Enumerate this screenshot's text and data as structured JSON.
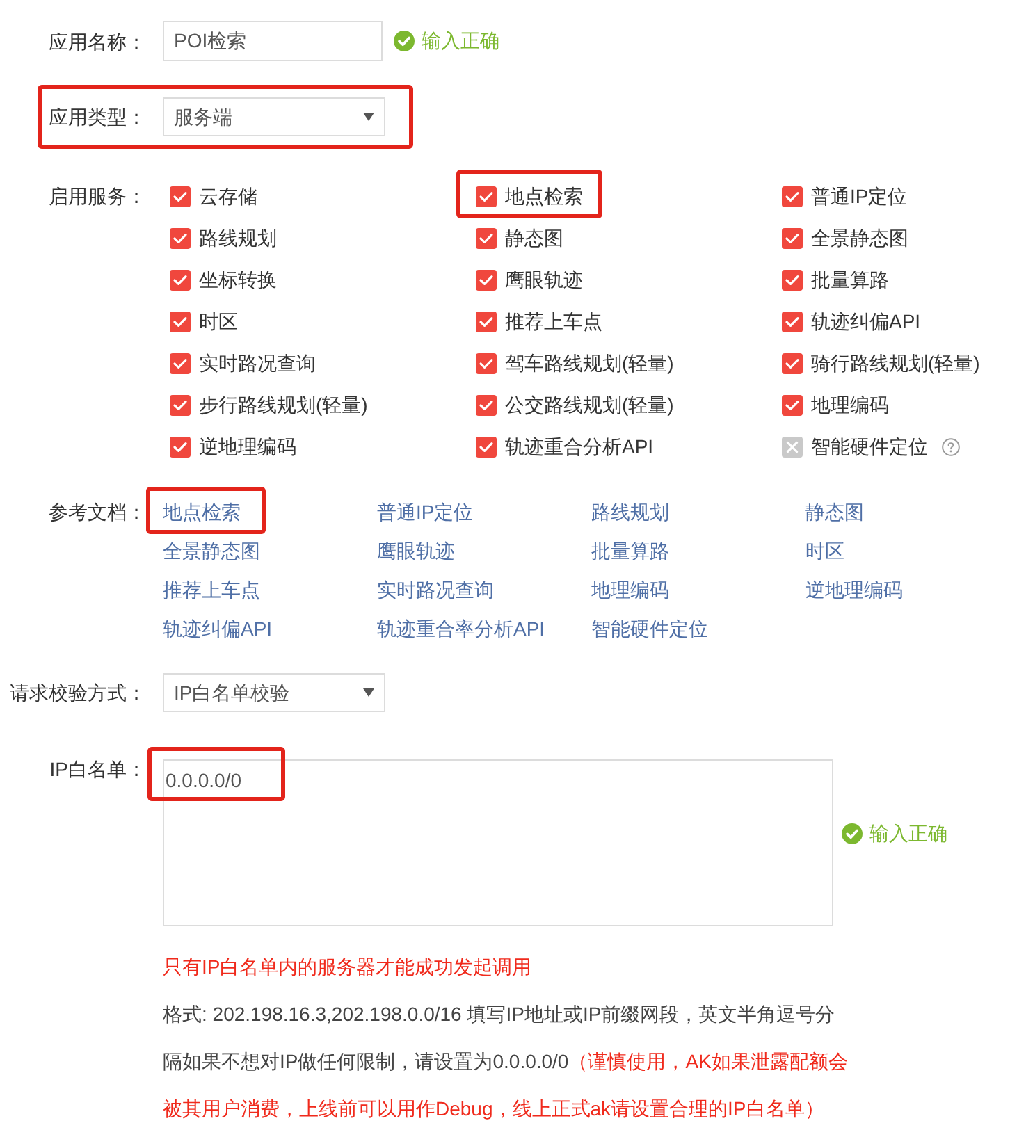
{
  "app_name": {
    "label": "应用名称：",
    "value": "POI检索",
    "validation": "输入正确"
  },
  "app_type": {
    "label": "应用类型：",
    "value": "服务端",
    "highlighted": true
  },
  "services": {
    "label": "启用服务：",
    "items": [
      {
        "label": "云存储",
        "checked": true,
        "highlighted": false,
        "help": false
      },
      {
        "label": "地点检索",
        "checked": true,
        "highlighted": true,
        "help": false
      },
      {
        "label": "普通IP定位",
        "checked": true,
        "highlighted": false,
        "help": false
      },
      {
        "label": "路线规划",
        "checked": true,
        "highlighted": false,
        "help": false
      },
      {
        "label": "静态图",
        "checked": true,
        "highlighted": false,
        "help": false
      },
      {
        "label": "全景静态图",
        "checked": true,
        "highlighted": false,
        "help": false
      },
      {
        "label": "坐标转换",
        "checked": true,
        "highlighted": false,
        "help": false
      },
      {
        "label": "鹰眼轨迹",
        "checked": true,
        "highlighted": false,
        "help": false
      },
      {
        "label": "批量算路",
        "checked": true,
        "highlighted": false,
        "help": false
      },
      {
        "label": "时区",
        "checked": true,
        "highlighted": false,
        "help": false
      },
      {
        "label": "推荐上车点",
        "checked": true,
        "highlighted": false,
        "help": false
      },
      {
        "label": "轨迹纠偏API",
        "checked": true,
        "highlighted": false,
        "help": false
      },
      {
        "label": "实时路况查询",
        "checked": true,
        "highlighted": false,
        "help": false
      },
      {
        "label": "驾车路线规划(轻量)",
        "checked": true,
        "highlighted": false,
        "help": false
      },
      {
        "label": "骑行路线规划(轻量)",
        "checked": true,
        "highlighted": false,
        "help": false
      },
      {
        "label": "步行路线规划(轻量)",
        "checked": true,
        "highlighted": false,
        "help": false
      },
      {
        "label": "公交路线规划(轻量)",
        "checked": true,
        "highlighted": false,
        "help": false
      },
      {
        "label": "地理编码",
        "checked": true,
        "highlighted": false,
        "help": false
      },
      {
        "label": "逆地理编码",
        "checked": true,
        "highlighted": false,
        "help": false
      },
      {
        "label": "轨迹重合分析API",
        "checked": true,
        "highlighted": false,
        "help": false
      },
      {
        "label": "智能硬件定位",
        "checked": false,
        "highlighted": false,
        "help": true
      }
    ]
  },
  "docs": {
    "label": "参考文档：",
    "links": [
      {
        "label": "地点检索",
        "highlighted": true
      },
      {
        "label": "普通IP定位",
        "highlighted": false
      },
      {
        "label": "路线规划",
        "highlighted": false
      },
      {
        "label": "静态图",
        "highlighted": false
      },
      {
        "label": "全景静态图",
        "highlighted": false
      },
      {
        "label": "鹰眼轨迹",
        "highlighted": false
      },
      {
        "label": "批量算路",
        "highlighted": false
      },
      {
        "label": "时区",
        "highlighted": false
      },
      {
        "label": "推荐上车点",
        "highlighted": false
      },
      {
        "label": "实时路况查询",
        "highlighted": false
      },
      {
        "label": "地理编码",
        "highlighted": false
      },
      {
        "label": "逆地理编码",
        "highlighted": false
      },
      {
        "label": "轨迹纠偏API",
        "highlighted": false
      },
      {
        "label": "轨迹重合率分析API",
        "highlighted": false
      },
      {
        "label": "智能硬件定位",
        "highlighted": false
      }
    ]
  },
  "verify_method": {
    "label": "请求校验方式：",
    "value": "IP白名单校验"
  },
  "ip_whitelist": {
    "label": "IP白名单：",
    "value": "0.0.0.0/0",
    "highlighted": true,
    "validation": "输入正确"
  },
  "notes": {
    "warning": "只有IP白名单内的服务器才能成功发起调用",
    "format": "格式: 202.198.16.3,202.198.0.0/16 填写IP地址或IP前缀网段，英文半角逗号分隔如果不想对IP做任何限制，请设置为0.0.0.0/0",
    "caution": "（谨慎使用，AK如果泄露配额会被其用户消费，上线前可以用作Debug，线上正式ak请设置合理的IP白名单）"
  }
}
